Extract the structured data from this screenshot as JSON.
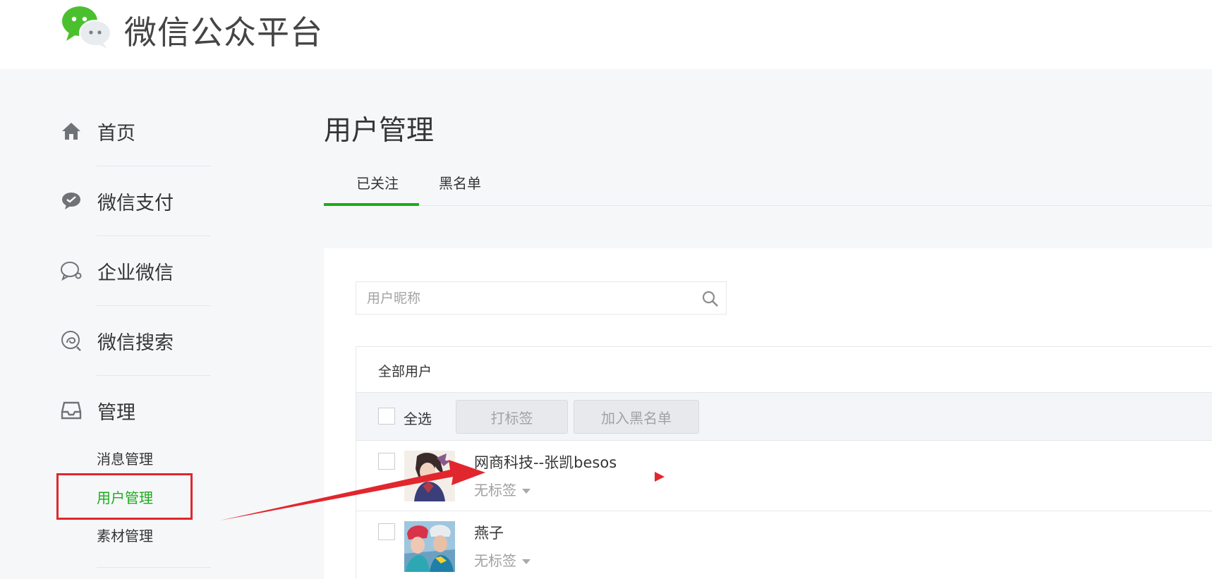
{
  "header": {
    "title": "微信公众平台"
  },
  "sidebar": {
    "items": [
      {
        "label": "首页",
        "icon": "home-icon"
      },
      {
        "label": "微信支付",
        "icon": "wechat-pay-icon"
      },
      {
        "label": "企业微信",
        "icon": "work-wechat-icon"
      },
      {
        "label": "微信搜索",
        "icon": "wechat-search-icon"
      },
      {
        "label": "管理",
        "icon": "inbox-icon"
      }
    ],
    "sub_items": [
      {
        "label": "消息管理"
      },
      {
        "label": "用户管理"
      },
      {
        "label": "素材管理"
      }
    ],
    "active_sub": "用户管理"
  },
  "main": {
    "title": "用户管理",
    "tabs": [
      {
        "label": "已关注",
        "active": true
      },
      {
        "label": "黑名单",
        "active": false
      }
    ],
    "search": {
      "placeholder": "用户昵称",
      "value": ""
    },
    "table": {
      "title": "全部用户",
      "select_all_label": "全选",
      "buttons": [
        {
          "label": "打标签"
        },
        {
          "label": "加入黑名单"
        }
      ],
      "rows": [
        {
          "nickname": "网商科技--张凯besos",
          "tag": "无标签"
        },
        {
          "nickname": "燕子",
          "tag": "无标签"
        }
      ]
    }
  },
  "colors": {
    "accent": "#1aad19",
    "annotation": "#e2262d"
  }
}
